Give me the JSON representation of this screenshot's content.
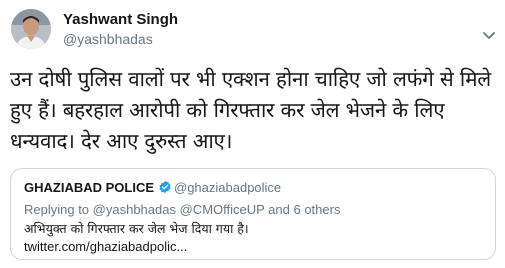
{
  "tweet": {
    "author": {
      "name": "Yashwant Singh",
      "handle": "@yashbhadas"
    },
    "text": "उन दोषी पुलिस वालों पर भी एक्शन होना चाहिए जो लफंगे से मिले हुए हैं। बहरहाल आरोपी को गिरफ्तार कर जेल भेजने के लिए धन्यवाद। देर आए दुरुस्त आए।",
    "more_menu_icon": "chevron-down-icon"
  },
  "quoted_tweet": {
    "author": {
      "name": "GHAZIABAD POLICE",
      "handle": "@ghaziabadpolice",
      "verified_icon": "verified-badge-icon"
    },
    "replying_to_label": "Replying to",
    "replying_to_user": "@yashbhadas",
    "replying_to_others": "@CMOfficeUP and 6 others",
    "text": "अभियुक्त को गिरफ्तार कर जेल भेज दिया गया है।",
    "link_text": "twitter.com/ghaziabadpolic..."
  },
  "colors": {
    "text_primary": "#14171a",
    "text_secondary": "#657786",
    "border": "#ccd6dd",
    "verified_blue": "#1da1f2"
  }
}
